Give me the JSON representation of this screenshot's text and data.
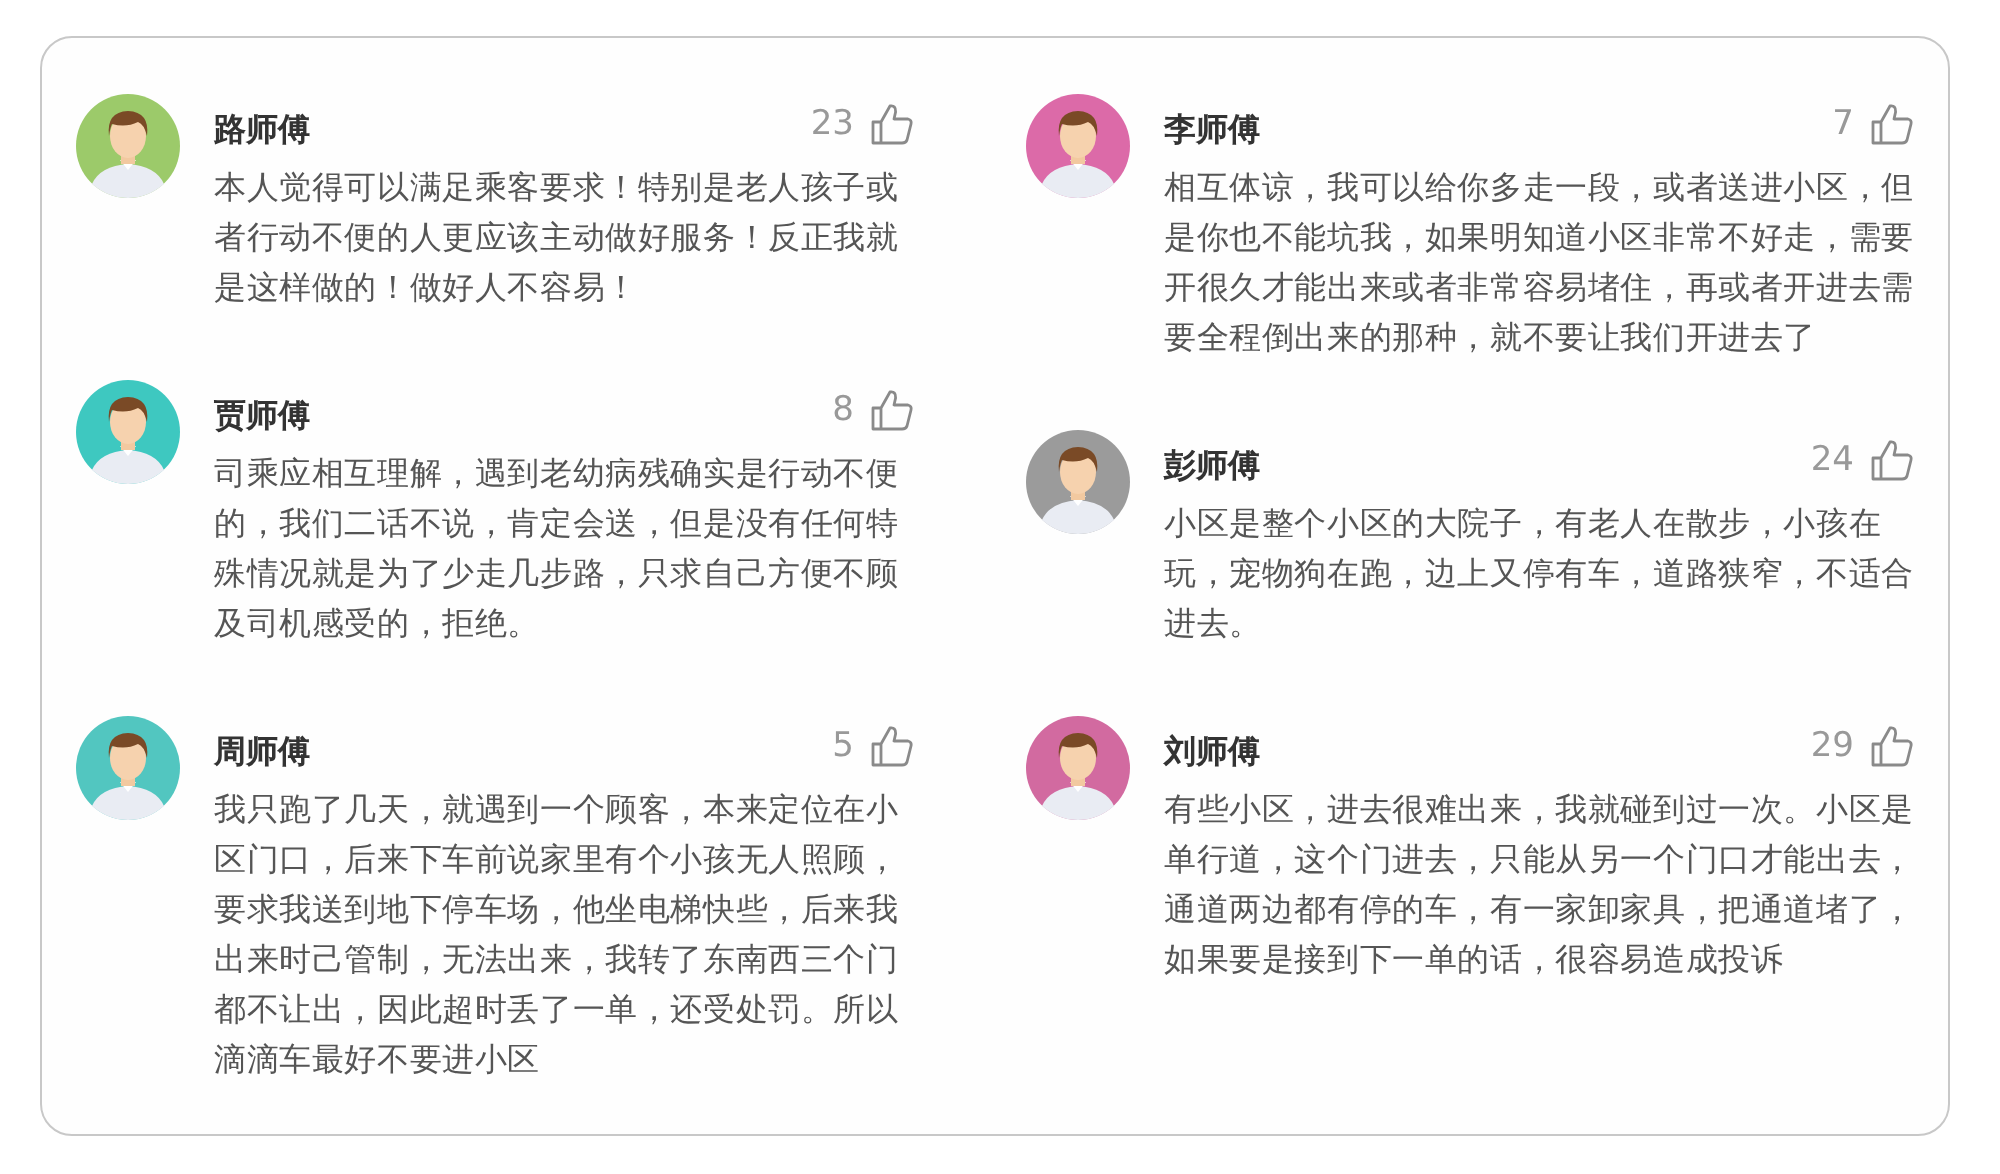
{
  "columns": [
    {
      "comments": [
        {
          "name": "路师傅",
          "likes": "23",
          "color": "#9cca6a",
          "text": "本人觉得可以满足乘客要求！特别是老人孩子或者行动不便的人更应该主动做好服务！反正我就是这样做的！做好人不容易！"
        },
        {
          "name": "贾师傅",
          "likes": "8",
          "color": "#3ec8c0",
          "text": "司乘应相互理解，遇到老幼病残确实是行动不便的，我们二话不说，肯定会送，但是没有任何特殊情况就是为了少走几步路，只求自己方便不顾及司机感受的，拒绝。"
        },
        {
          "name": "周师傅",
          "likes": "5",
          "color": "#52c6c0",
          "text": "我只跑了几天，就遇到一个顾客，本来定位在小区门口，后来下车前说家里有个小孩无人照顾，要求我送到地下停车场，他坐电梯快些，后来我出来时己管制，无法出来，我转了东南西三个门都不让出，因此超时丢了一单，还受处罚。所以滴滴车最好不要进小区"
        }
      ]
    },
    {
      "comments": [
        {
          "name": "李师傅",
          "likes": "7",
          "color": "#dc6aa8",
          "text": "相互体谅，我可以给你多走一段，或者送进小区，但是你也不能坑我，如果明知道小区非常不好走，需要开很久才能出来或者非常容易堵住，再或者开进去需要全程倒出来的那种，就不要让我们开进去了"
        },
        {
          "name": "彭师傅",
          "likes": "24",
          "color": "#9b9b9b",
          "text": "小区是整个小区的大院子，有老人在散步，小孩在玩，宠物狗在跑，边上又停有车，道路狭窄，不适合进去。"
        },
        {
          "name": "刘师傅",
          "likes": "29",
          "color": "#d26aa0",
          "text": "有些小区，进去很难出来，我就碰到过一次。小区是单行道，这个门进去，只能从另一个门口才能出去，通道两边都有停的车，有一家卸家具，把通道堵了，如果要是接到下一单的话，很容易造成投诉"
        }
      ]
    }
  ]
}
